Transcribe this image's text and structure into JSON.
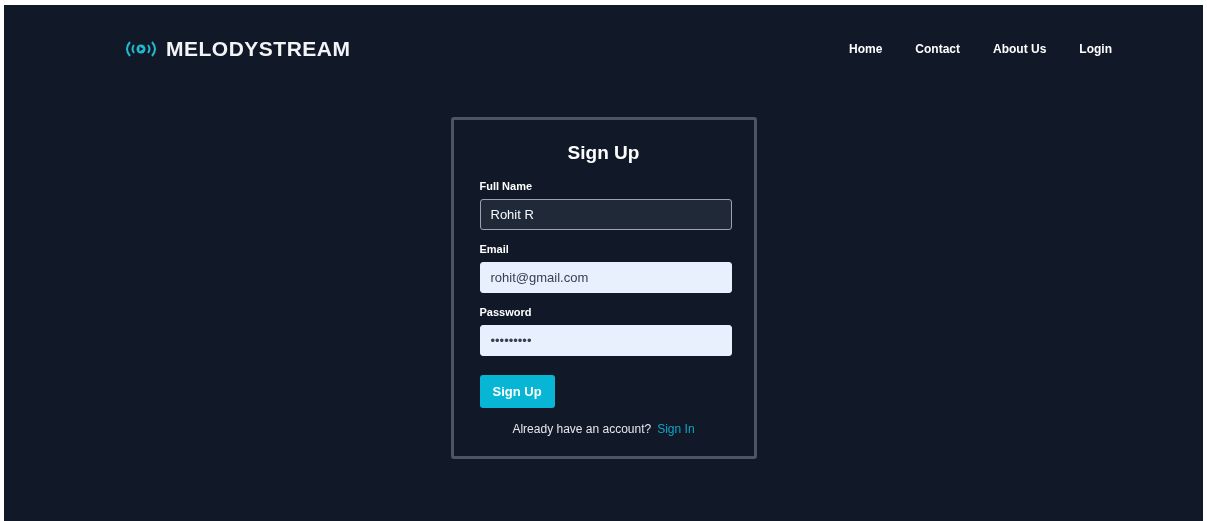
{
  "brand": {
    "name": "MELODYSTREAM"
  },
  "nav": [
    {
      "label": "Home"
    },
    {
      "label": "Contact"
    },
    {
      "label": "About Us"
    },
    {
      "label": "Login"
    }
  ],
  "form": {
    "title": "Sign Up",
    "fields": [
      {
        "label": "Full Name",
        "value": "Rohit R",
        "focused": true
      },
      {
        "label": "Email",
        "value": "rohit@gmail.com",
        "focused": false
      },
      {
        "label": "Password",
        "value": "•••••••••",
        "focused": false
      }
    ],
    "submit": "Sign Up",
    "footer_text": "Already have an account?",
    "footer_link": "Sign In"
  }
}
